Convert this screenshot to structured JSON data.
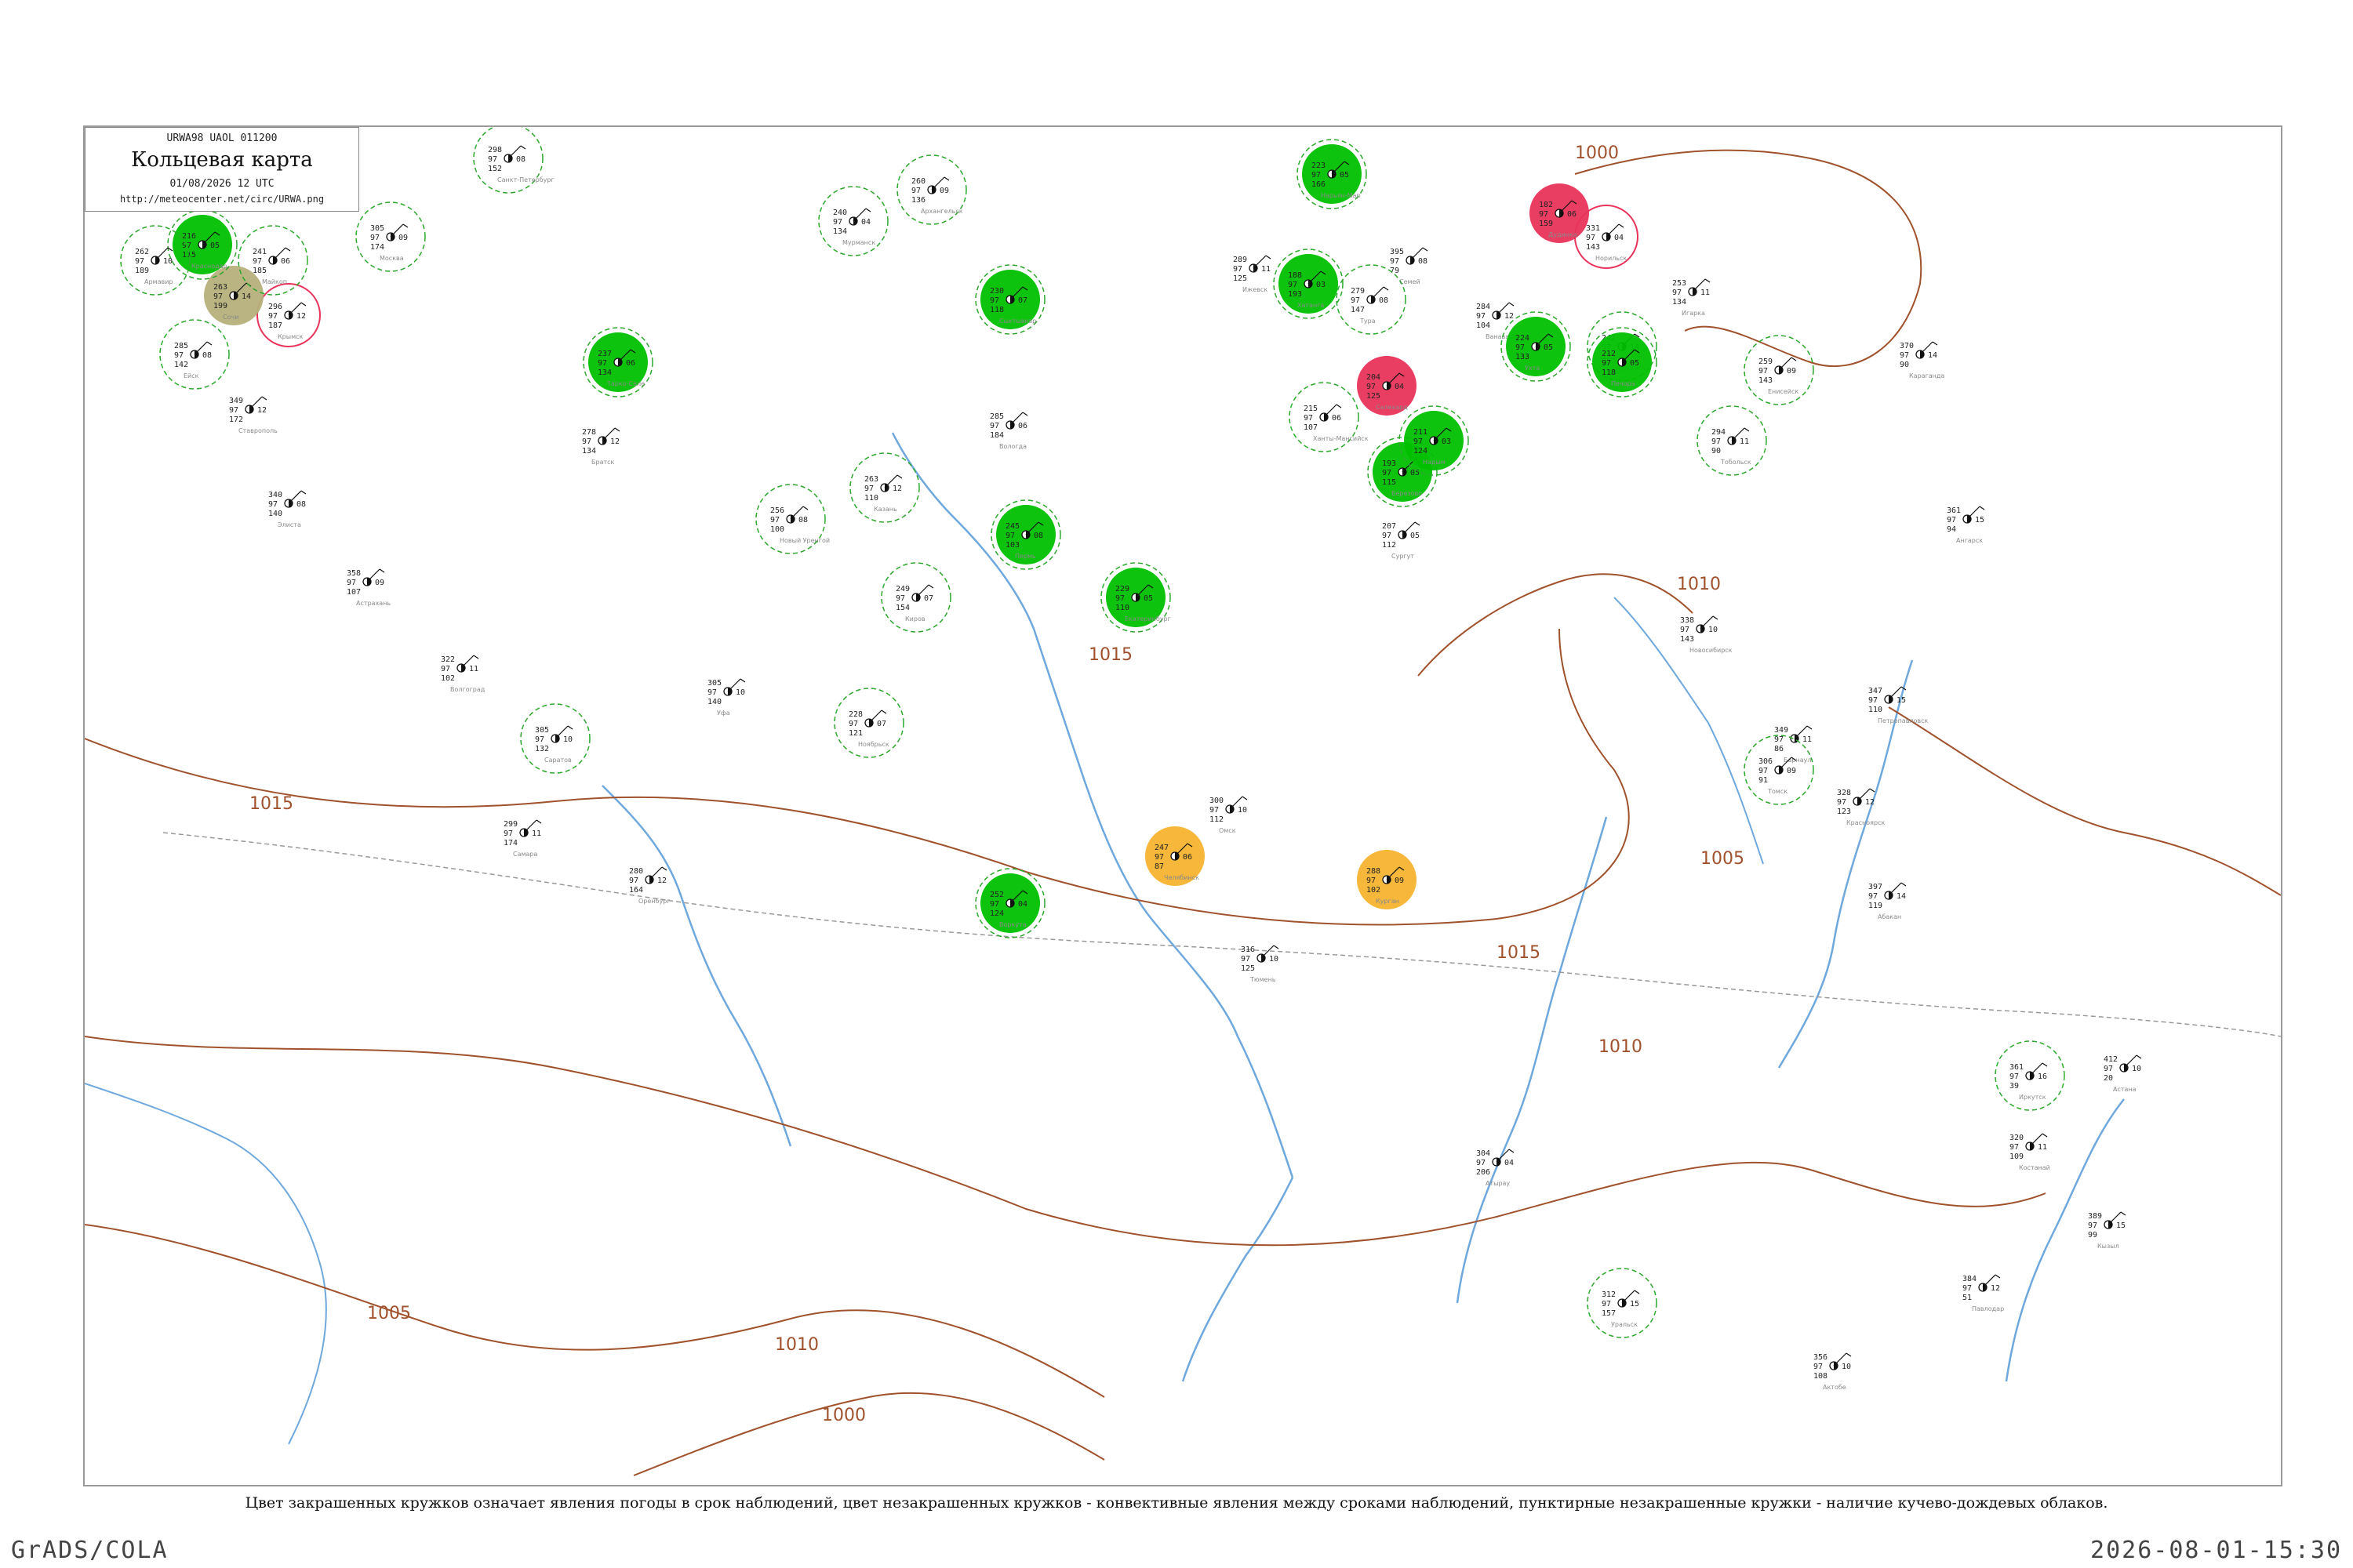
{
  "header": {
    "code_line": "URWA98  UAOL  011200",
    "title": "Кольцевая карта",
    "time": "01/08/2026 12 UTC",
    "url": "http://meteocenter.net/circ/URWA.png"
  },
  "legend_note": "Цвет закрашенных кружков означает явления погоды в срок наблюдений, цвет незакрашенных кружков - конвективные явления между сроками наблюдений, пунктирные незакрашенные кружки - наличие кучево-дождевых облаков.",
  "footer": {
    "left": "GrADS/COLA",
    "right": "2026-08-01-15:30"
  },
  "colors": {
    "isobar": "#a0522d",
    "rivers": "#6fa8dc",
    "borders": "#999999",
    "fill_green": "#00c000",
    "fill_red": "#e8345a",
    "fill_orange": "#f5b330",
    "fill_olive": "#b5b07a",
    "cb_dash": "#2ea82e"
  },
  "isobar_labels": [
    "1000",
    "1005",
    "1010",
    "1015"
  ],
  "stations": [
    {
      "name": "Крымск",
      "t": "296",
      "p": "97",
      "d": "12",
      "pr": "187",
      "sym": "red-ring"
    },
    {
      "name": "Сочи",
      "t": "263",
      "p": "97",
      "d": "14",
      "pr": "199",
      "sym": "olive"
    },
    {
      "name": "Краснодар",
      "t": "216",
      "p": "97",
      "d": "05",
      "pr": "115",
      "sym": "green"
    },
    {
      "name": "Майкоп",
      "t": "241",
      "p": "97",
      "d": "06",
      "pr": "185",
      "sym": "cb"
    },
    {
      "name": "Армавир",
      "t": "262",
      "p": "97",
      "d": "10",
      "pr": "189",
      "sym": "cb"
    },
    {
      "name": "Ейск",
      "t": "285",
      "p": "97",
      "d": "08",
      "pr": "142",
      "sym": "cb"
    },
    {
      "name": "Ставрополь",
      "t": "349",
      "p": "97",
      "d": "12",
      "pr": "172",
      "sym": "none"
    },
    {
      "name": "Элиста",
      "t": "340",
      "p": "97",
      "d": "08",
      "pr": "140",
      "sym": "none"
    },
    {
      "name": "Астрахань",
      "t": "358",
      "p": "97",
      "d": "09",
      "pr": "107",
      "sym": "none"
    },
    {
      "name": "Волгоград",
      "t": "322",
      "p": "97",
      "d": "11",
      "pr": "102",
      "sym": "none"
    },
    {
      "name": "Саратов",
      "t": "305",
      "p": "97",
      "d": "10",
      "pr": "132",
      "sym": "cb"
    },
    {
      "name": "Самара",
      "t": "299",
      "p": "97",
      "d": "11",
      "pr": "174",
      "sym": "none"
    },
    {
      "name": "Оренбург",
      "t": "280",
      "p": "97",
      "d": "12",
      "pr": "164",
      "sym": "none"
    },
    {
      "name": "Уфа",
      "t": "305",
      "p": "97",
      "d": "10",
      "pr": "140",
      "sym": "none"
    },
    {
      "name": "Казань",
      "t": "263",
      "p": "97",
      "d": "12",
      "pr": "110",
      "sym": "cb"
    },
    {
      "name": "Пермь",
      "t": "245",
      "p": "97",
      "d": "08",
      "pr": "103",
      "sym": "green"
    },
    {
      "name": "Екатеринбург",
      "t": "229",
      "p": "97",
      "d": "05",
      "pr": "110",
      "sym": "green"
    },
    {
      "name": "Челябинск",
      "t": "247",
      "p": "97",
      "d": "06",
      "pr": "87",
      "sym": "orange"
    },
    {
      "name": "Курган",
      "t": "288",
      "p": "97",
      "d": "09",
      "pr": "102",
      "sym": "orange"
    },
    {
      "name": "Тюмень",
      "t": "316",
      "p": "97",
      "d": "10",
      "pr": "125",
      "sym": "none"
    },
    {
      "name": "Омск",
      "t": "300",
      "p": "97",
      "d": "10",
      "pr": "112",
      "sym": "none"
    },
    {
      "name": "Сыктывкар",
      "t": "230",
      "p": "97",
      "d": "07",
      "pr": "118",
      "sym": "green"
    },
    {
      "name": "Нарьян-Мар",
      "t": "223",
      "p": "97",
      "d": "05",
      "pr": "166",
      "sym": "green"
    },
    {
      "name": "Салехард",
      "t": "204",
      "p": "97",
      "d": "04",
      "pr": "125",
      "sym": "red"
    },
    {
      "name": "Ханты-Мансийск",
      "t": "215",
      "p": "97",
      "d": "06",
      "pr": "107",
      "sym": "cb"
    },
    {
      "name": "Сургут",
      "t": "207",
      "p": "97",
      "d": "05",
      "pr": "112",
      "sym": "none"
    },
    {
      "name": "Новосибирск",
      "t": "338",
      "p": "97",
      "d": "10",
      "pr": "143",
      "sym": "none"
    },
    {
      "name": "Барнаул",
      "t": "349",
      "p": "97",
      "d": "11",
      "pr": "86",
      "sym": "none"
    },
    {
      "name": "Томск",
      "t": "306",
      "p": "97",
      "d": "09",
      "pr": "91",
      "sym": "cb"
    },
    {
      "name": "Норильск",
      "t": "331",
      "p": "97",
      "d": "04",
      "pr": "143",
      "sym": "red-ring"
    },
    {
      "name": "Дудинка",
      "t": "182",
      "p": "97",
      "d": "06",
      "pr": "159",
      "sym": "red"
    },
    {
      "name": "Игарка",
      "t": "253",
      "p": "97",
      "d": "11",
      "pr": "134",
      "sym": "none"
    },
    {
      "name": "Туруханск",
      "t": "242",
      "p": "97",
      "d": "14",
      "pr": "123",
      "sym": "cb"
    },
    {
      "name": "Енисейск",
      "t": "259",
      "p": "97",
      "d": "09",
      "pr": "143",
      "sym": "cb"
    },
    {
      "name": "Красноярск",
      "t": "328",
      "p": "97",
      "d": "12",
      "pr": "123",
      "sym": "none"
    },
    {
      "name": "Абакан",
      "t": "397",
      "p": "97",
      "d": "14",
      "pr": "119",
      "sym": "none"
    },
    {
      "name": "Кызыл",
      "t": "389",
      "p": "97",
      "d": "15",
      "pr": "99",
      "sym": "none"
    },
    {
      "name": "Иркутск",
      "t": "361",
      "p": "97",
      "d": "16",
      "pr": "39",
      "sym": "cb"
    },
    {
      "name": "Ангарск",
      "t": "361",
      "p": "97",
      "d": "15",
      "pr": "94",
      "sym": "none"
    },
    {
      "name": "Братск",
      "t": "278",
      "p": "97",
      "d": "12",
      "pr": "134",
      "sym": "none"
    },
    {
      "name": "Москва",
      "t": "305",
      "p": "97",
      "d": "09",
      "pr": "174",
      "sym": "cb"
    },
    {
      "name": "Санкт-Петербург",
      "t": "298",
      "p": "97",
      "d": "08",
      "pr": "152",
      "sym": "cb"
    },
    {
      "name": "Мурманск",
      "t": "240",
      "p": "97",
      "d": "04",
      "pr": "134",
      "sym": "cb"
    },
    {
      "name": "Архангельск",
      "t": "260",
      "p": "97",
      "d": "09",
      "pr": "136",
      "sym": "cb"
    },
    {
      "name": "Вологда",
      "t": "285",
      "p": "97",
      "d": "06",
      "pr": "184",
      "sym": "none"
    },
    {
      "name": "Киров",
      "t": "249",
      "p": "97",
      "d": "07",
      "pr": "154",
      "sym": "cb"
    },
    {
      "name": "Ижевск",
      "t": "289",
      "p": "97",
      "d": "11",
      "pr": "125",
      "sym": "none"
    },
    {
      "name": "Воркута",
      "t": "252",
      "p": "97",
      "d": "04",
      "pr": "124",
      "sym": "green"
    },
    {
      "name": "Тобольск",
      "t": "294",
      "p": "97",
      "d": "11",
      "pr": "90",
      "sym": "cb"
    },
    {
      "name": "Петропавловск",
      "t": "347",
      "p": "97",
      "d": "15",
      "pr": "110",
      "sym": "none"
    },
    {
      "name": "Актобе",
      "t": "356",
      "p": "97",
      "d": "10",
      "pr": "108",
      "sym": "none"
    },
    {
      "name": "Уральск",
      "t": "312",
      "p": "97",
      "d": "15",
      "pr": "157",
      "sym": "cb"
    },
    {
      "name": "Атырау",
      "t": "304",
      "p": "97",
      "d": "04",
      "pr": "206",
      "sym": "none"
    },
    {
      "name": "Костанай",
      "t": "320",
      "p": "97",
      "d": "11",
      "pr": "109",
      "sym": "none"
    },
    {
      "name": "Астана",
      "t": "412",
      "p": "97",
      "d": "10",
      "pr": "20",
      "sym": "none"
    },
    {
      "name": "Павлодар",
      "t": "384",
      "p": "97",
      "d": "12",
      "pr": "51",
      "sym": "none"
    },
    {
      "name": "Семей",
      "t": "395",
      "p": "97",
      "d": "08",
      "pr": "79",
      "sym": "none"
    },
    {
      "name": "Караганда",
      "t": "370",
      "p": "97",
      "d": "14",
      "pr": "90",
      "sym": "none"
    },
    {
      "name": "Хатанга",
      "t": "188",
      "p": "97",
      "d": "03",
      "pr": "193",
      "sym": "green"
    },
    {
      "name": "Тура",
      "t": "279",
      "p": "97",
      "d": "08",
      "pr": "147",
      "sym": "cb"
    },
    {
      "name": "Ванавара",
      "t": "284",
      "p": "97",
      "d": "12",
      "pr": "104",
      "sym": "none"
    },
    {
      "name": "Ухта",
      "t": "224",
      "p": "97",
      "d": "05",
      "pr": "133",
      "sym": "green"
    },
    {
      "name": "Печора",
      "t": "212",
      "p": "97",
      "d": "05",
      "pr": "118",
      "sym": "green"
    },
    {
      "name": "Березово",
      "t": "193",
      "p": "97",
      "d": "05",
      "pr": "115",
      "sym": "green"
    },
    {
      "name": "Надым",
      "t": "211",
      "p": "97",
      "d": "03",
      "pr": "124",
      "sym": "green"
    },
    {
      "name": "Тарко-Сале",
      "t": "237",
      "p": "97",
      "d": "06",
      "pr": "134",
      "sym": "green"
    },
    {
      "name": "Новый Уренгой",
      "t": "256",
      "p": "97",
      "d": "08",
      "pr": "100",
      "sym": "cb"
    },
    {
      "name": "Ноябрьск",
      "t": "228",
      "p": "97",
      "d": "07",
      "pr": "121",
      "sym": "cb"
    }
  ]
}
